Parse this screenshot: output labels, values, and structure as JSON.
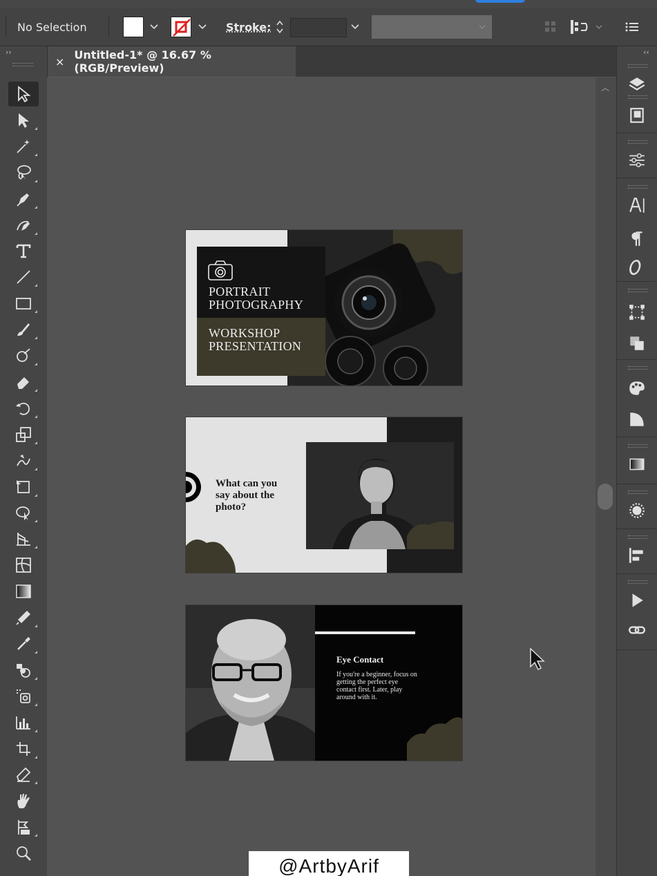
{
  "control_bar": {
    "selection_label": "No Selection",
    "stroke_label": "Stroke:",
    "icons": [
      "fill-swatch",
      "stroke-swatch",
      "align-icon",
      "more-options-icon"
    ]
  },
  "document_tab": {
    "close_glyph": "×",
    "title": "Untitled-1* @ 16.67 % (RGB/Preview)"
  },
  "toolbar": {
    "tools": [
      "selection-tool",
      "direct-selection-tool",
      "magic-wand-tool",
      "lasso-tool",
      "pen-tool",
      "curvature-tool",
      "type-tool",
      "line-tool",
      "rectangle-tool",
      "paintbrush-tool",
      "shaper-tool",
      "eraser-tool",
      "rotate-tool",
      "scale-tool",
      "warp-tool",
      "free-transform-tool",
      "shape-builder-tool",
      "perspective-grid-tool",
      "mesh-tool",
      "gradient-tool",
      "eyedropper-blend-tool",
      "eyedropper-tool",
      "symbol-sprayer-tool",
      "live-paint-tool",
      "column-graph-tool",
      "artboard-tool",
      "slice-tool",
      "hand-tool",
      "print-tiling-tool",
      "zoom-tool"
    ]
  },
  "right_panel": {
    "icons": [
      "layers-icon",
      "libraries-icon",
      "properties-icon",
      "character-icon",
      "paragraph-icon",
      "opentype-icon",
      "transform-icon",
      "pathfinder-icon",
      "color-icon",
      "color-guide-icon",
      "gradient-icon",
      "appearance-icon",
      "align-icon",
      "actions-icon",
      "links-icon"
    ]
  },
  "artboards": [
    {
      "heading_line1": "PORTRAIT",
      "heading_line2": "PHOTOGRAPHY",
      "sub_line1": "WORKSHOP",
      "sub_line2": "PRESENTATION"
    },
    {
      "question_line1": "What can you",
      "question_line2": "say about the",
      "question_line3": "photo?"
    },
    {
      "title": "Eye Contact",
      "body_line1": "If you're a beginner, focus on",
      "body_line2": "getting the perfect eye",
      "body_line3": "contact first. Later, play",
      "body_line4": "around with it."
    }
  ],
  "watermark": "@ArtbyArif",
  "colors": {
    "olive": "#3d3a2b",
    "workspace": "#535353"
  }
}
